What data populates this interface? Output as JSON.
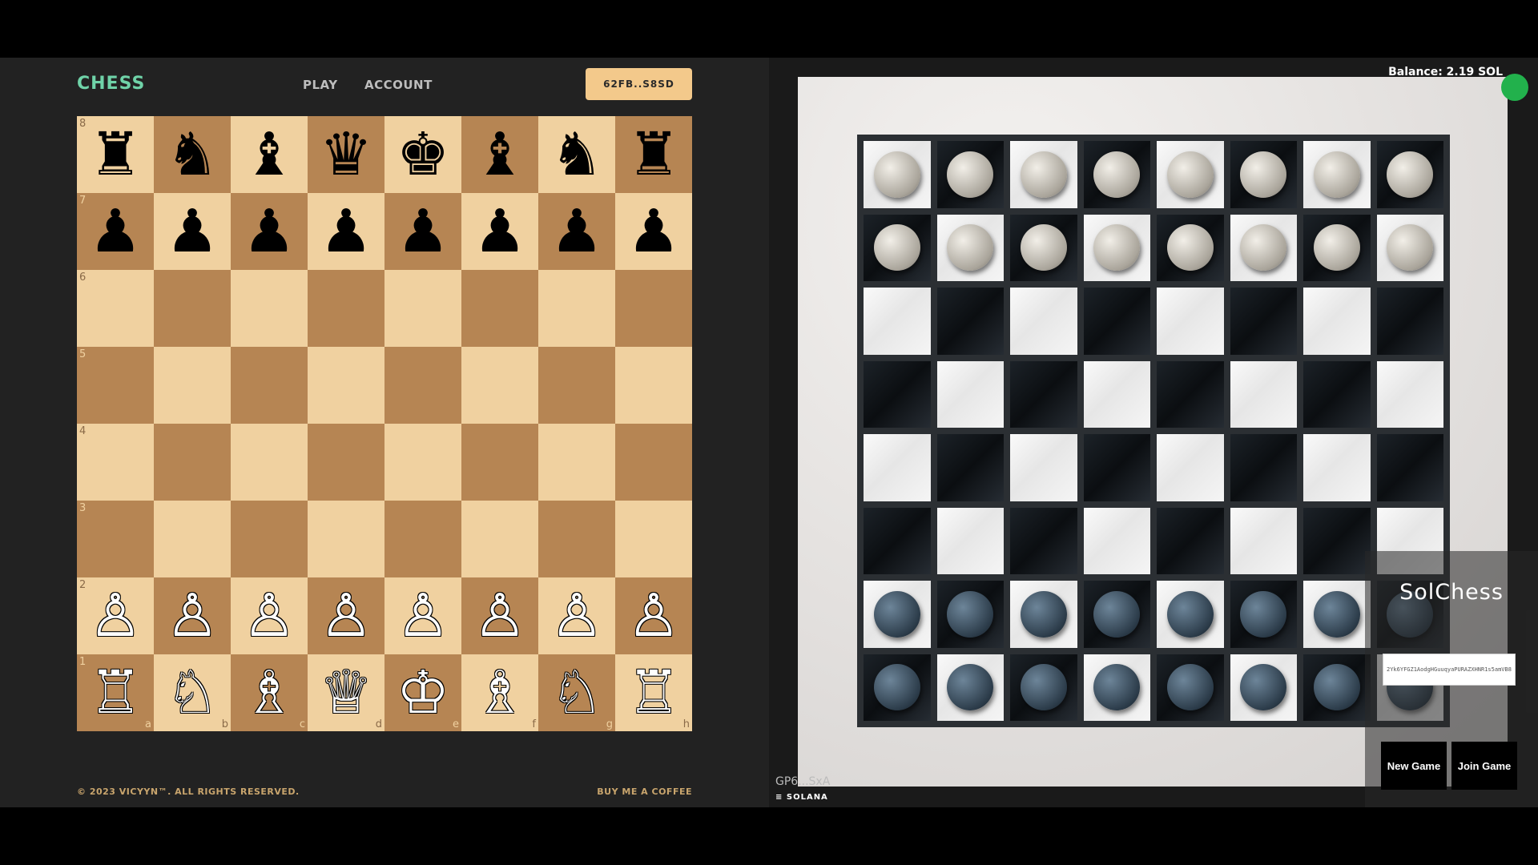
{
  "left": {
    "logo": "CHESS",
    "nav": {
      "play": "PLAY",
      "account": "ACCOUNT"
    },
    "wallet": "62FB..S8SD",
    "footer": {
      "copyright": "© 2023 VICYYN™. ALL RIGHTS RESERVED.",
      "coffee": "BUY ME A COFFEE"
    },
    "colors": {
      "light_square": "#f0d1a0",
      "dark_square": "#b68553",
      "logo": "#6fd3a8",
      "wallet_bg": "#f3c98b"
    },
    "board": {
      "ranks": [
        "8",
        "7",
        "6",
        "5",
        "4",
        "3",
        "2",
        "1"
      ],
      "files": [
        "a",
        "b",
        "c",
        "d",
        "e",
        "f",
        "g",
        "h"
      ],
      "position": [
        [
          "♜",
          "♞",
          "♝",
          "♛",
          "♚",
          "♝",
          "♞",
          "♜"
        ],
        [
          "♟",
          "♟",
          "♟",
          "♟",
          "♟",
          "♟",
          "♟",
          "♟"
        ],
        [
          "",
          "",
          "",
          "",
          "",
          "",
          "",
          ""
        ],
        [
          "",
          "",
          "",
          "",
          "",
          "",
          "",
          ""
        ],
        [
          "",
          "",
          "",
          "",
          "",
          "",
          "",
          ""
        ],
        [
          "",
          "",
          "",
          "",
          "",
          "",
          "",
          ""
        ],
        [
          "♙",
          "♙",
          "♙",
          "♙",
          "♙",
          "♙",
          "♙",
          "♙"
        ],
        [
          "♖",
          "♘",
          "♗",
          "♕",
          "♔",
          "♗",
          "♘",
          "♖"
        ]
      ]
    }
  },
  "right": {
    "balance": "Balance: 2.19 SOL",
    "title": "SolChess",
    "input_value": "2Yk6YFGZ1AodgHGuuqyaPURAZXHNR1s5amVB8Sj",
    "new_game": "New Game",
    "join_game": "Join Game",
    "game_id": "GP6...SxA",
    "solana": "SOLANA",
    "colors": {
      "status_dot": "#22b14c"
    },
    "board": {
      "position": [
        [
          "w",
          "w",
          "w",
          "w",
          "w",
          "w",
          "w",
          "w"
        ],
        [
          "w",
          "w",
          "w",
          "w",
          "w",
          "w",
          "w",
          "w"
        ],
        [
          "",
          "",
          "",
          "",
          "",
          "",
          "",
          ""
        ],
        [
          "",
          "",
          "",
          "",
          "",
          "",
          "",
          ""
        ],
        [
          "",
          "",
          "",
          "",
          "",
          "",
          "",
          ""
        ],
        [
          "",
          "",
          "",
          "",
          "",
          "",
          "",
          ""
        ],
        [
          "b",
          "b",
          "b",
          "b",
          "b",
          "b",
          "b",
          "b"
        ],
        [
          "b",
          "b",
          "b",
          "b",
          "b",
          "b",
          "b",
          "b"
        ]
      ]
    }
  }
}
